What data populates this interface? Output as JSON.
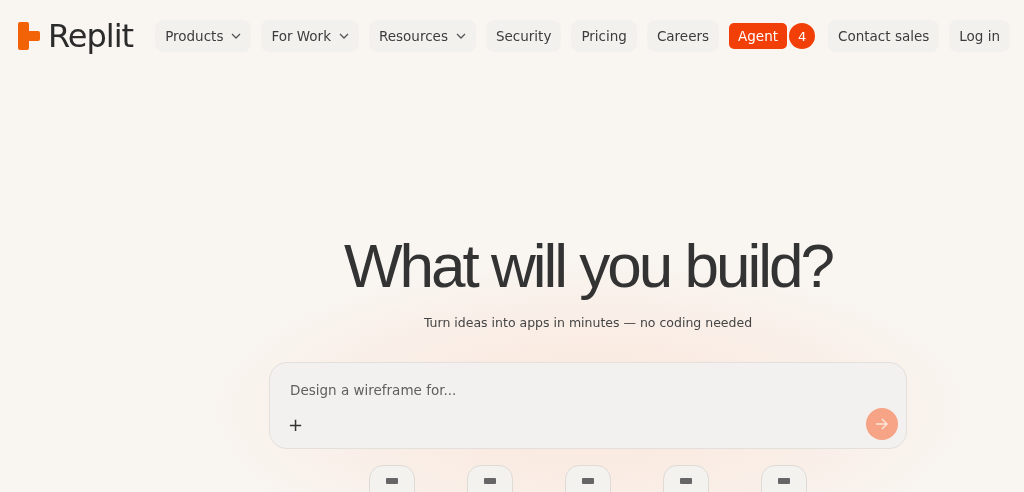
{
  "header": {
    "logo_text": "Replit",
    "nav": [
      {
        "label": "Products",
        "dropdown": true
      },
      {
        "label": "For Work",
        "dropdown": true
      },
      {
        "label": "Resources",
        "dropdown": true
      },
      {
        "label": "Security",
        "dropdown": false
      },
      {
        "label": "Pricing",
        "dropdown": false
      },
      {
        "label": "Careers",
        "dropdown": false
      }
    ],
    "agent": {
      "label": "Agent",
      "badge": "4"
    },
    "actions": [
      "Contact sales",
      "Log in"
    ]
  },
  "hero": {
    "title": "What will you build?",
    "subtitle": "Turn ideas into apps in minutes — no coding needed",
    "prompt": {
      "placeholder": "Design a wireframe for...",
      "attach": "+"
    }
  }
}
